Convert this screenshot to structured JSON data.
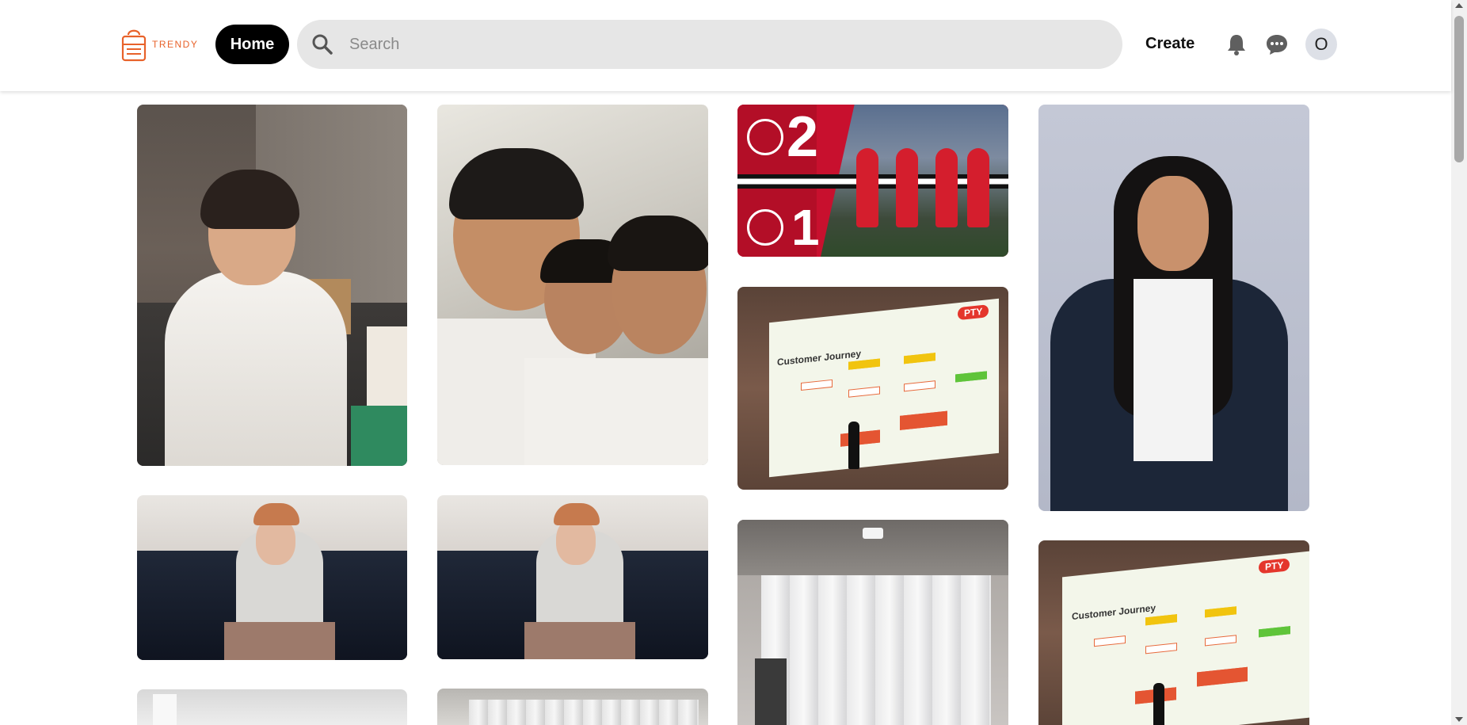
{
  "header": {
    "logo_text": "TRENDY",
    "home_label": "Home",
    "search_placeholder": "Search",
    "create_label": "Create",
    "avatar_initial": "O"
  },
  "colors": {
    "brand": "#e8622a",
    "home_bg": "#000000",
    "search_bg": "#e6e6e6",
    "avatar_bg": "#dde0e7"
  },
  "icons": [
    "trendy-logo-icon",
    "search-icon",
    "bell-icon",
    "chat-icon"
  ],
  "pins": [
    {
      "subject": "man-white-tshirt"
    },
    {
      "subject": "friends-selfie"
    },
    {
      "subject": "football-score",
      "score_top": "2",
      "score_bottom": "1"
    },
    {
      "subject": "presentation",
      "slide_title": "Customer Journey",
      "tag": "PTY"
    },
    {
      "subject": "long-hair-portrait"
    },
    {
      "subject": "sofa-cap"
    },
    {
      "subject": "sofa-cap"
    },
    {
      "subject": "curtain-room"
    },
    {
      "subject": "presentation",
      "slide_title": "Customer Journey",
      "tag": "PTY"
    },
    {
      "subject": "room-partial"
    },
    {
      "subject": "curtain-partial"
    }
  ]
}
